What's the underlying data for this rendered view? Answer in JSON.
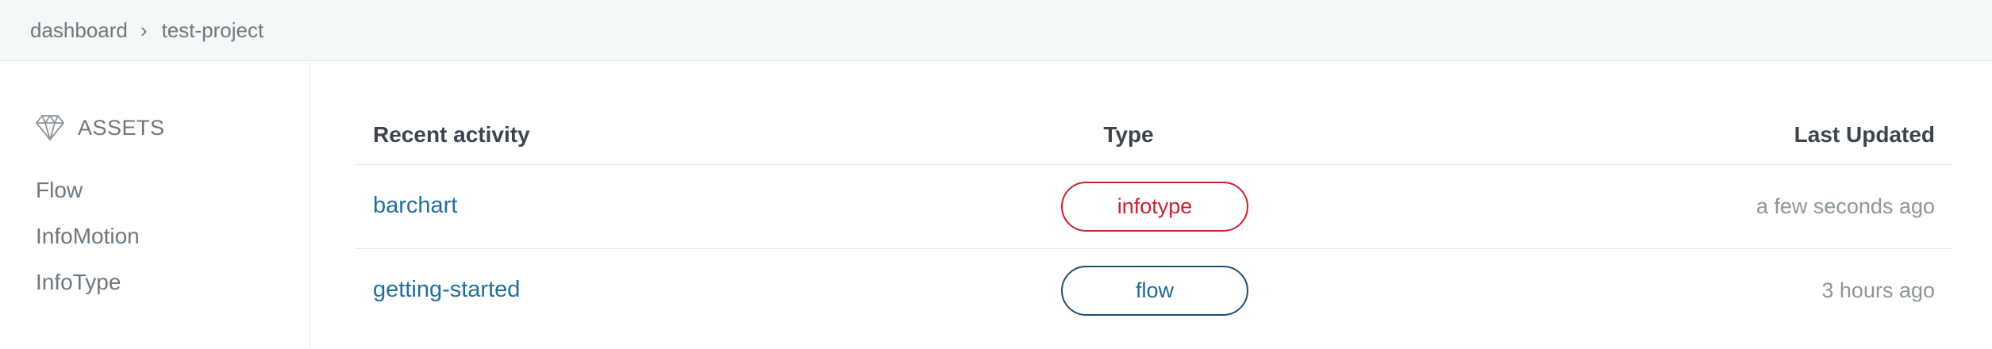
{
  "breadcrumb": {
    "items": [
      "dashboard",
      "test-project"
    ],
    "separator": "›"
  },
  "sidebar": {
    "heading": "ASSETS",
    "heading_icon": "diamond-icon",
    "items": [
      {
        "label": "Flow"
      },
      {
        "label": "InfoMotion"
      },
      {
        "label": "InfoType"
      }
    ]
  },
  "table": {
    "headers": {
      "activity": "Recent activity",
      "type": "Type",
      "updated": "Last Updated"
    },
    "rows": [
      {
        "name": "barchart",
        "type": "infotype",
        "updated": "a few seconds ago"
      },
      {
        "name": "getting-started",
        "type": "flow",
        "updated": "3 hours ago"
      }
    ]
  },
  "colors": {
    "link": "#1f6f9c",
    "infotype_badge": "#c8202f",
    "flow_badge": "#186f8e",
    "topbar_bg": "#f5f8f9"
  }
}
